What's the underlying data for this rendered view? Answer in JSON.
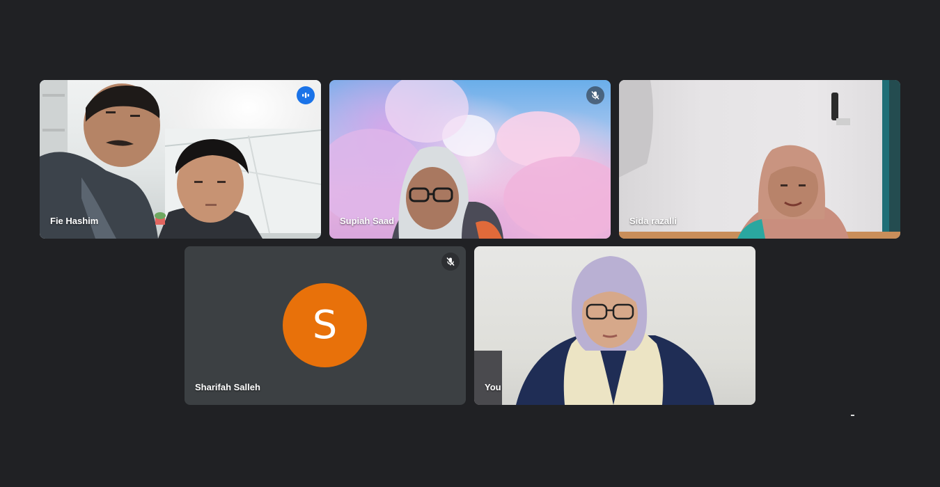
{
  "participants": [
    {
      "name": "Fie Hashim",
      "state": "speaking",
      "indicator_icon": "audio-level-icon"
    },
    {
      "name": "Supiah Saad",
      "state": "muted",
      "indicator_icon": "mic-off-icon"
    },
    {
      "name": "Sida razalli",
      "state": "unmuted"
    },
    {
      "name": "Sharifah Salleh",
      "state": "muted",
      "indicator_icon": "mic-off-icon",
      "avatar_initial": "S",
      "avatar_color": "#e8710a",
      "camera": "off"
    },
    {
      "name": "You",
      "state": "unmuted"
    }
  ],
  "colors": {
    "background": "#202124",
    "tile_off": "#3c4043",
    "speaking_border": "#8ab4f8",
    "speaking_badge": "#1a73e8"
  }
}
